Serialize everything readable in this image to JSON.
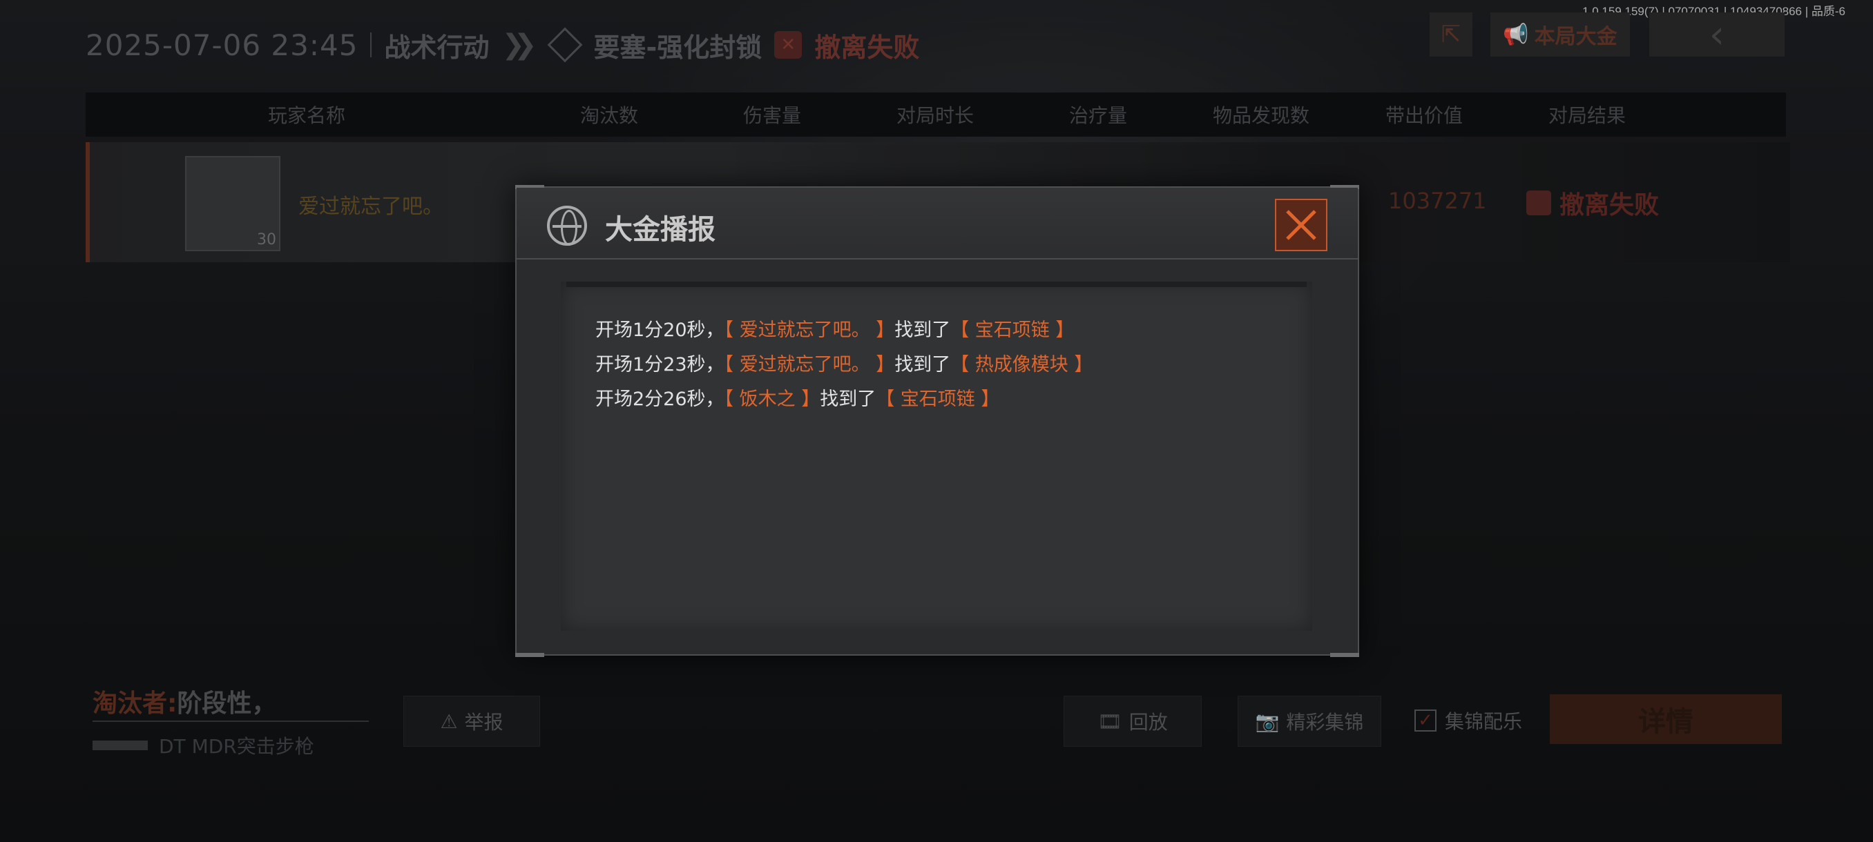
{
  "version": "1.0.159.159(7) | 07070031 | 10493470866 | 品质-6",
  "header": {
    "datetime": "2025-07-06 23:45",
    "mode": "战术行动",
    "map": "要塞-强化封锁",
    "result": "撤离失败"
  },
  "top_buttons": {
    "share_icon": "share-icon",
    "gold_label": "本局大金",
    "back_icon": "chevron-left-icon"
  },
  "table": {
    "columns": [
      "玩家名称",
      "淘汰数",
      "伤害量",
      "对局时长",
      "治疗量",
      "物品发现数",
      "带出价值",
      "对局结果"
    ],
    "row": {
      "level": "30",
      "player": "爱过就忘了吧。",
      "value": "1037271",
      "result": "撤离失败"
    }
  },
  "bottom": {
    "killer_label": "淘汰者:",
    "killer_name": "阶段性，",
    "weapon": "DT MDR突击步枪",
    "report": "举报",
    "replay": "回放",
    "highlights": "精彩集锦",
    "music": "集锦配乐",
    "music_checked": true,
    "detail": "详情"
  },
  "modal": {
    "title": "大金播报",
    "entries": [
      {
        "time": "开场1分20秒，",
        "player": "【 爱过就忘了吧。 】",
        "verb": "找到了",
        "item": "【 宝石项链 】"
      },
      {
        "time": "开场1分23秒，",
        "player": "【 爱过就忘了吧。 】",
        "verb": "找到了",
        "item": "【 热成像模块 】"
      },
      {
        "time": "开场2分26秒，",
        "player": "【 饭木之 】",
        "verb": "找到了",
        "item": "【 宝石项链 】"
      }
    ]
  },
  "colors": {
    "accent": "#e0652d",
    "close_border": "#c8562b"
  }
}
